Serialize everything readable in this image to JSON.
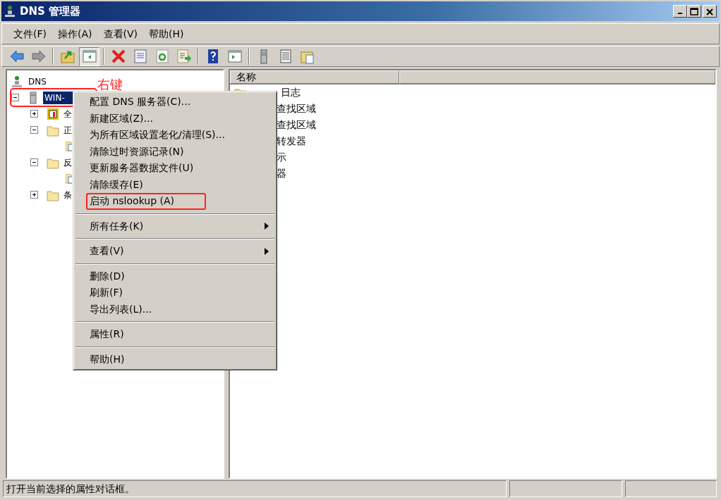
{
  "window": {
    "title": "DNS 管理器"
  },
  "menu_bar": [
    "文件(F)",
    "操作(A)",
    "查看(V)",
    "帮助(H)"
  ],
  "toolbar": [
    {
      "kind": "back",
      "pressed": false
    },
    {
      "kind": "forward",
      "pressed": false
    },
    {
      "kind": "sep"
    },
    {
      "kind": "up",
      "pressed": false
    },
    {
      "kind": "tree",
      "pressed": true
    },
    {
      "kind": "sep"
    },
    {
      "kind": "delete",
      "pressed": false
    },
    {
      "kind": "properties",
      "pressed": false
    },
    {
      "kind": "refresh",
      "pressed": false
    },
    {
      "kind": "export",
      "pressed": false
    },
    {
      "kind": "sep"
    },
    {
      "kind": "help",
      "pressed": false
    },
    {
      "kind": "panel",
      "pressed": false
    },
    {
      "kind": "sep"
    },
    {
      "kind": "server",
      "pressed": false
    },
    {
      "kind": "list",
      "pressed": false
    },
    {
      "kind": "folderdoc",
      "pressed": false
    }
  ],
  "tree": [
    {
      "label": "DNS",
      "kind": "dns",
      "children": [
        {
          "label": "WIN-",
          "kind": "server",
          "expanded": true,
          "selected": true,
          "annotated": true,
          "children": [
            {
              "label": "全",
              "kind": "log",
              "expanded": false
            },
            {
              "label": "正",
              "kind": "folder",
              "expanded": true,
              "children": [
                {
                  "kind": "zone"
                }
              ]
            },
            {
              "label": "反",
              "kind": "folder",
              "expanded": true,
              "children": [
                {
                  "kind": "zone"
                }
              ]
            },
            {
              "label": "条",
              "kind": "folder",
              "expanded": false
            }
          ]
        }
      ]
    }
  ],
  "annotation": {
    "text": "右键"
  },
  "list": {
    "columns": [
      "名称"
    ],
    "rows": [
      {
        "name": "日志"
      },
      {
        "name": "查找区域"
      },
      {
        "name": "查找区域"
      },
      {
        "name": "转发器"
      },
      {
        "name": "示"
      },
      {
        "name": "器"
      }
    ]
  },
  "context_menu": [
    [
      {
        "label": "配置 DNS 服务器(C)...",
        "kind": "item",
        "annotated": false
      },
      {
        "label": "新建区域(Z)...",
        "kind": "item",
        "annotated": false
      },
      {
        "label": "为所有区域设置老化/清理(S)...",
        "kind": "item",
        "annotated": false
      },
      {
        "label": "清除过时资源记录(N)",
        "kind": "item",
        "annotated": false
      },
      {
        "label": "更新服务器数据文件(U)",
        "kind": "item",
        "annotated": false
      },
      {
        "label": "清除缓存(E)",
        "kind": "item",
        "annotated": false
      },
      {
        "label": "启动 nslookup (A)",
        "kind": "item",
        "annotated": true
      }
    ],
    [
      {
        "label": "所有任务(K)",
        "kind": "submenu",
        "annotated": false
      }
    ],
    [
      {
        "label": "查看(V)",
        "kind": "submenu",
        "annotated": false
      }
    ],
    [
      {
        "label": "删除(D)",
        "kind": "item",
        "annotated": false
      },
      {
        "label": "刷新(F)",
        "kind": "item",
        "annotated": false
      },
      {
        "label": "导出列表(L)...",
        "kind": "item",
        "annotated": false
      }
    ],
    [
      {
        "label": "属性(R)",
        "kind": "item",
        "annotated": false
      }
    ],
    [
      {
        "label": "帮助(H)",
        "kind": "item",
        "annotated": false
      }
    ]
  ],
  "status_bar": {
    "text": "打开当前选择的属性对话框。"
  }
}
